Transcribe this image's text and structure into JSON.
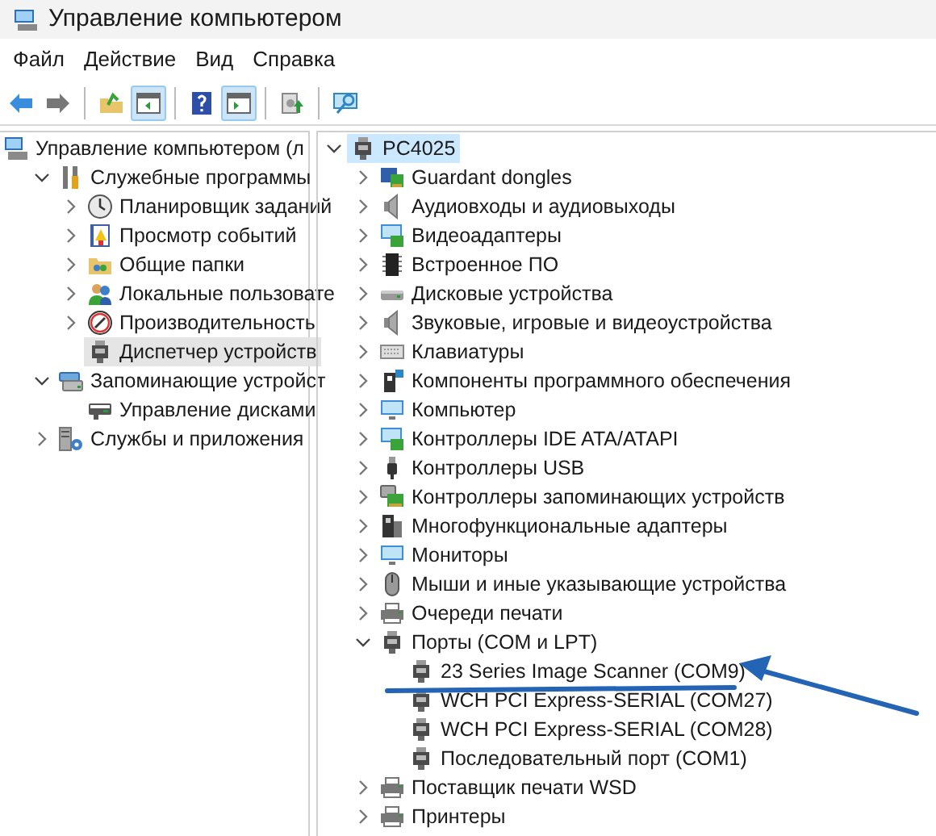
{
  "window": {
    "title": "Управление компьютером"
  },
  "menu": [
    "Файл",
    "Действие",
    "Вид",
    "Справка"
  ],
  "toolbar": [
    {
      "pressed": false
    },
    {
      "pressed": false
    },
    {
      "pressed": false
    },
    {
      "pressed": true
    },
    {
      "pressed": false
    },
    {
      "pressed": true
    },
    {
      "pressed": false
    },
    {
      "pressed": false
    }
  ],
  "console_tree": [
    {
      "label": "Управление компьютером (л",
      "kind": "root",
      "selected": false,
      "children": [
        {
          "label": "Служебные программы",
          "kind": "expanded",
          "selected": false,
          "children": [
            {
              "label": "Планировщик заданий",
              "kind": "collapsed",
              "selected": false
            },
            {
              "label": "Просмотр событий",
              "kind": "collapsed",
              "selected": false
            },
            {
              "label": "Общие папки",
              "kind": "collapsed",
              "selected": false
            },
            {
              "label": "Локальные пользовате",
              "kind": "collapsed",
              "selected": false
            },
            {
              "label": "Производительность",
              "kind": "collapsed",
              "selected": false
            },
            {
              "label": "Диспетчер устройств",
              "kind": "leaf",
              "selected": true
            }
          ]
        },
        {
          "label": "Запоминающие устройст",
          "kind": "expanded",
          "selected": false,
          "children": [
            {
              "label": "Управление дисками",
              "kind": "leaf",
              "selected": false
            }
          ]
        },
        {
          "label": "Службы и приложения",
          "kind": "collapsed",
          "selected": false
        }
      ]
    }
  ],
  "device_tree": [
    {
      "label": "PC4025",
      "kind": "expanded",
      "selected": true,
      "children": [
        {
          "label": "Guardant dongles",
          "kind": "collapsed",
          "selected": false
        },
        {
          "label": "Аудиовходы и аудиовыходы",
          "kind": "collapsed",
          "selected": false
        },
        {
          "label": "Видеоадаптеры",
          "kind": "collapsed",
          "selected": false
        },
        {
          "label": "Встроенное ПО",
          "kind": "collapsed",
          "selected": false
        },
        {
          "label": "Дисковые устройства",
          "kind": "collapsed",
          "selected": false
        },
        {
          "label": "Звуковые, игровые и видеоустройства",
          "kind": "collapsed",
          "selected": false
        },
        {
          "label": "Клавиатуры",
          "kind": "collapsed",
          "selected": false
        },
        {
          "label": "Компоненты программного обеспечения",
          "kind": "collapsed",
          "selected": false
        },
        {
          "label": "Компьютер",
          "kind": "collapsed",
          "selected": false
        },
        {
          "label": "Контроллеры IDE ATA/ATAPI",
          "kind": "collapsed",
          "selected": false
        },
        {
          "label": "Контроллеры USB",
          "kind": "collapsed",
          "selected": false
        },
        {
          "label": "Контроллеры запоминающих устройств",
          "kind": "collapsed",
          "selected": false
        },
        {
          "label": "Многофункциональные адаптеры",
          "kind": "collapsed",
          "selected": false
        },
        {
          "label": "Мониторы",
          "kind": "collapsed",
          "selected": false
        },
        {
          "label": "Мыши и иные указывающие устройства",
          "kind": "collapsed",
          "selected": false
        },
        {
          "label": "Очереди печати",
          "kind": "collapsed",
          "selected": false
        },
        {
          "label": "Порты (COM и LPT)",
          "kind": "expanded",
          "selected": false,
          "children": [
            {
              "label": "23 Series Image Scanner (COM9)",
              "kind": "leaf",
              "selected": false
            },
            {
              "label": "WCH PCI Express-SERIAL (COM27)",
              "kind": "leaf",
              "selected": false
            },
            {
              "label": "WCH PCI Express-SERIAL (COM28)",
              "kind": "leaf",
              "selected": false
            },
            {
              "label": "Последовательный порт (COM1)",
              "kind": "leaf",
              "selected": false
            }
          ]
        },
        {
          "label": "Поставщик печати WSD",
          "kind": "collapsed",
          "selected": false
        },
        {
          "label": "Принтеры",
          "kind": "collapsed",
          "selected": false
        }
      ]
    }
  ]
}
